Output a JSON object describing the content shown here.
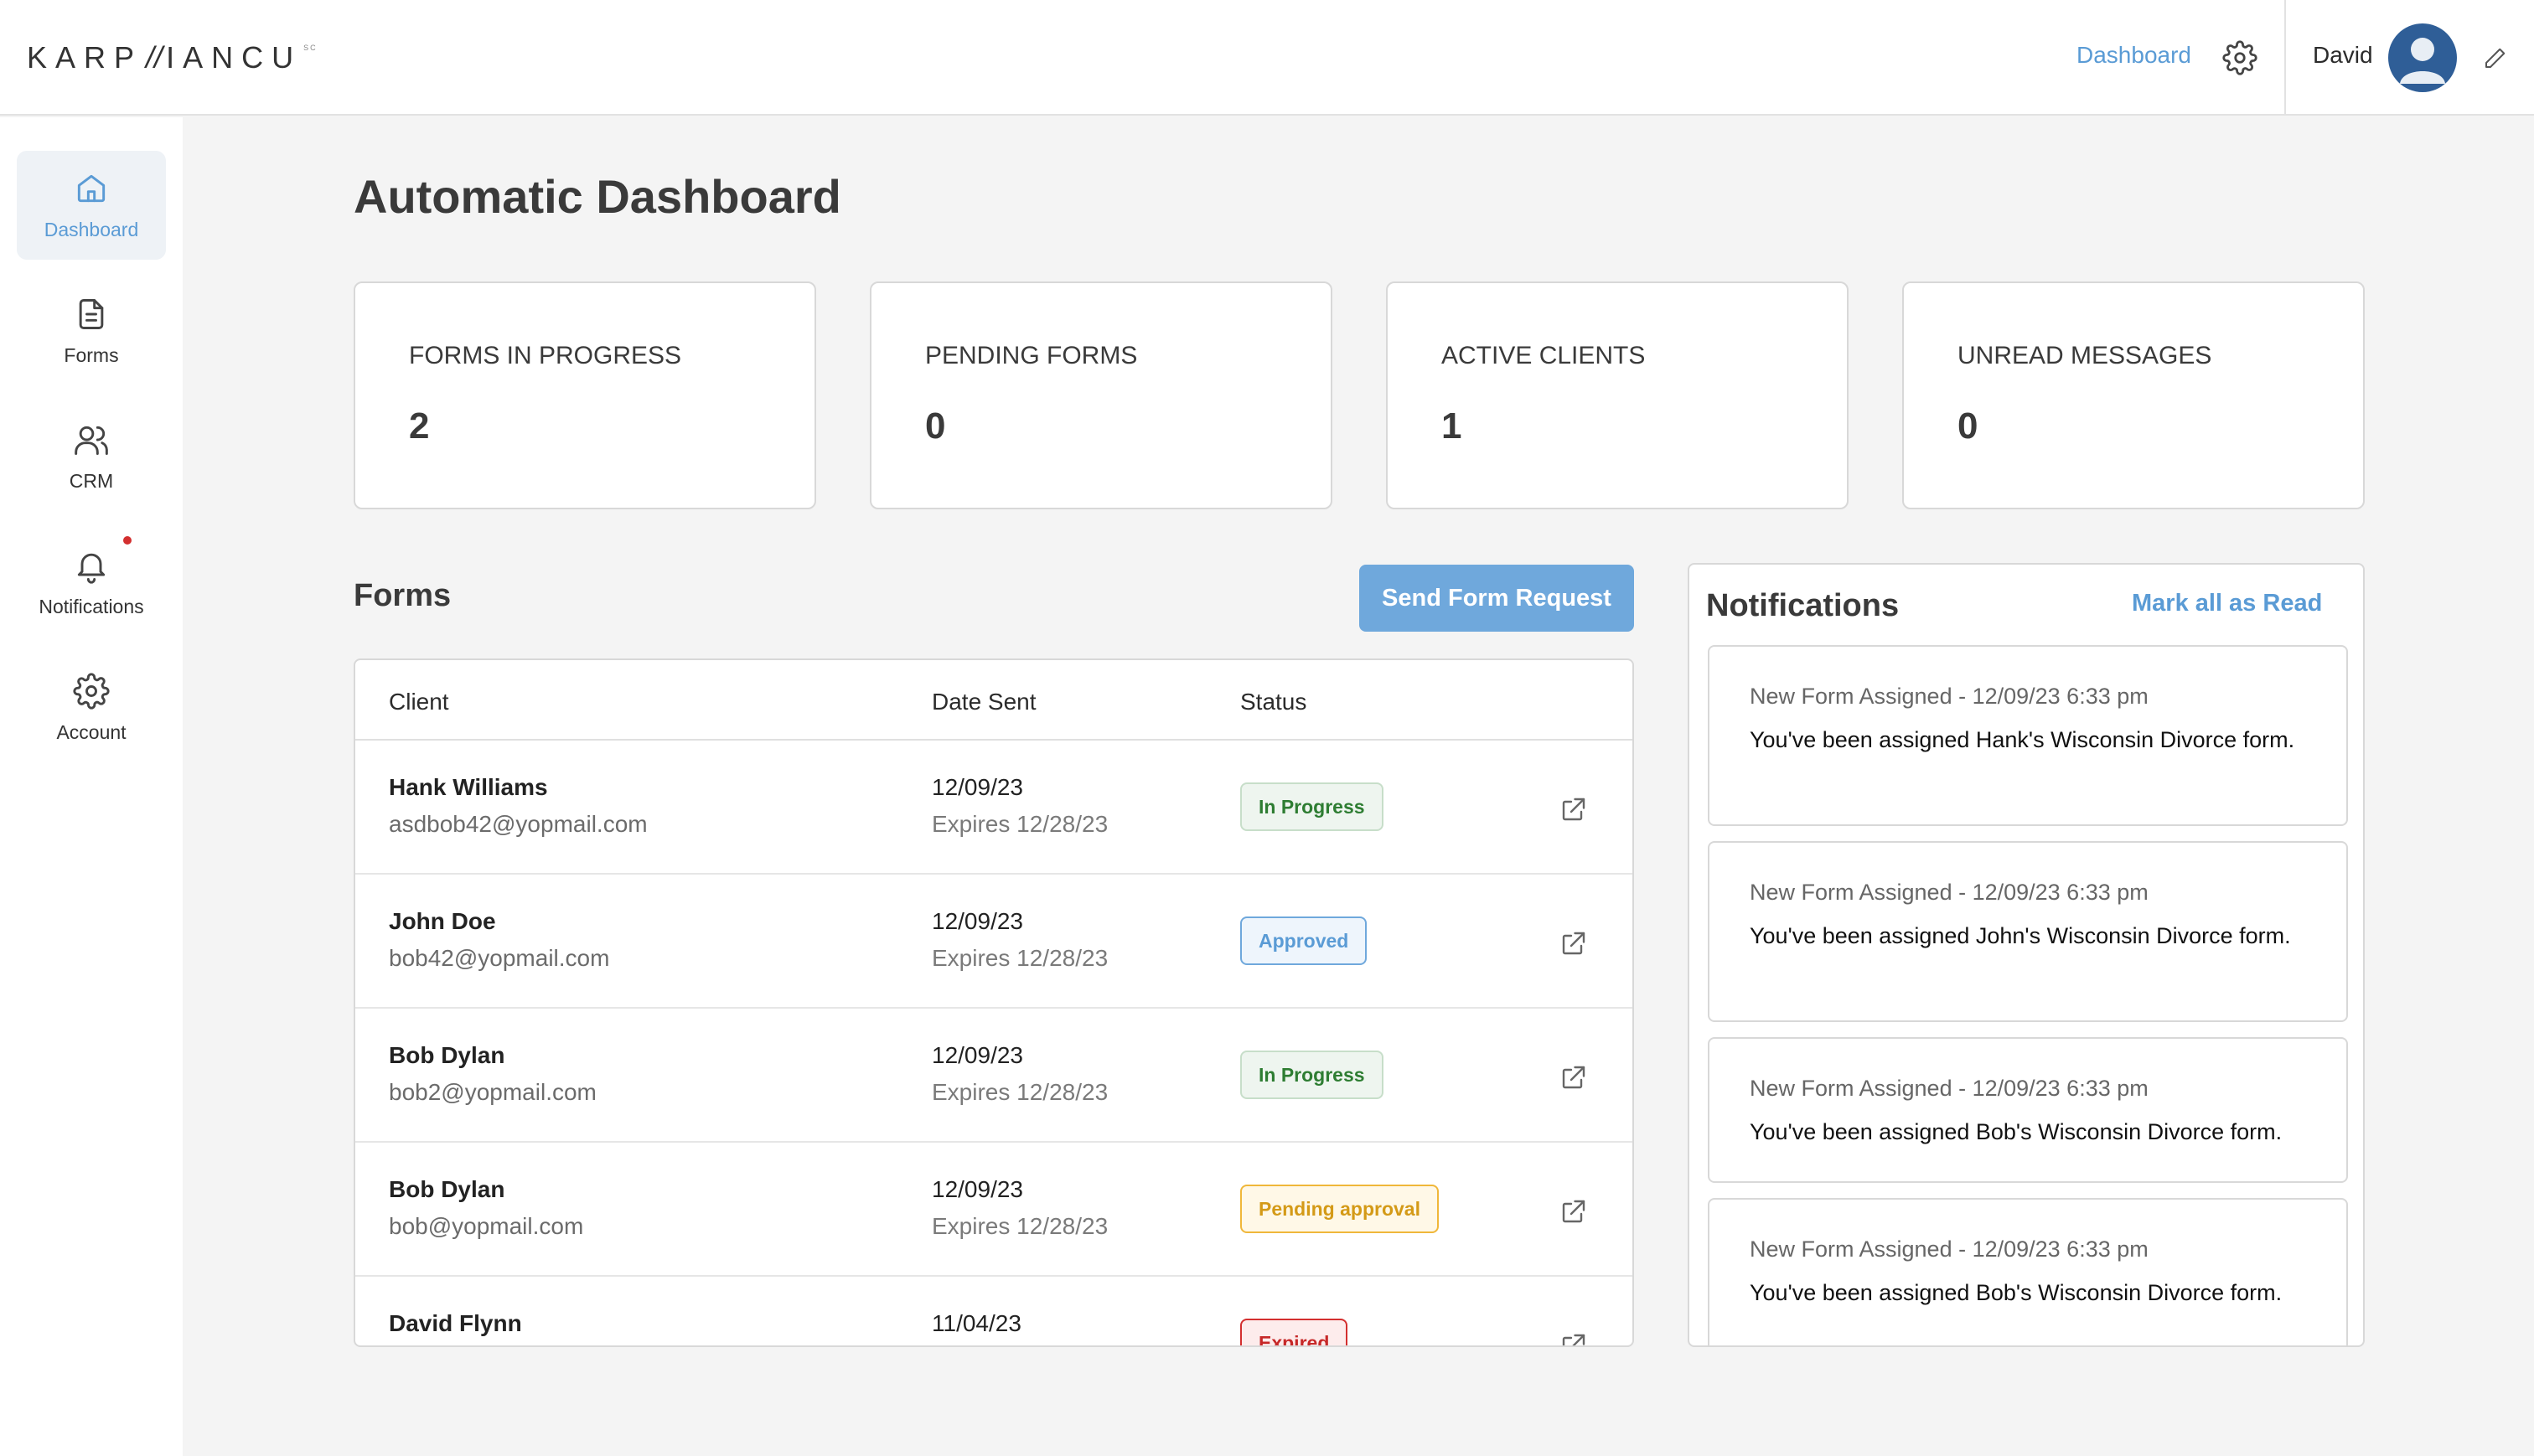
{
  "header": {
    "logo_main": "KARP",
    "logo_slash": "//",
    "logo_tail": "IANCU",
    "logo_sup": "SC",
    "nav_link": "Dashboard",
    "user_name": "David",
    "icons": [
      "gear-icon",
      "avatar",
      "pencil-icon"
    ]
  },
  "sidebar": {
    "items": [
      {
        "label": "Dashboard",
        "icon": "home-icon",
        "active": true
      },
      {
        "label": "Forms",
        "icon": "document-icon"
      },
      {
        "label": "CRM",
        "icon": "users-icon"
      },
      {
        "label": "Notifications",
        "icon": "bell-icon",
        "has_dot": true
      },
      {
        "label": "Account",
        "icon": "gear-icon"
      }
    ]
  },
  "main": {
    "title": "Automatic Dashboard",
    "stats": [
      {
        "label": "FORMS IN PROGRESS",
        "value": "2"
      },
      {
        "label": "PENDING FORMS",
        "value": "0"
      },
      {
        "label": "ACTIVE CLIENTS",
        "value": "1"
      },
      {
        "label": "UNREAD MESSAGES",
        "value": "0"
      }
    ]
  },
  "forms": {
    "title": "Forms",
    "send_button": "Send Form Request",
    "columns": [
      "Client",
      "Date Sent",
      "Status"
    ],
    "rows": [
      {
        "name": "Hank Williams",
        "email": "asdbob42@yopmail.com",
        "date": "12/09/23",
        "expires": "Expires 12/28/23",
        "status": "In Progress"
      },
      {
        "name": "John Doe",
        "email": "bob42@yopmail.com",
        "date": "12/09/23",
        "expires": "Expires 12/28/23",
        "status": "Approved"
      },
      {
        "name": "Bob Dylan",
        "email": "bob2@yopmail.com",
        "date": "12/09/23",
        "expires": "Expires 12/28/23",
        "status": "In Progress"
      },
      {
        "name": "Bob Dylan",
        "email": "bob@yopmail.com",
        "date": "12/09/23",
        "expires": "Expires 12/28/23",
        "status": "Pending approval"
      },
      {
        "name": "David Flynn",
        "email": "",
        "date": "11/04/23",
        "expires": "",
        "status": "Expired"
      }
    ]
  },
  "notifications": {
    "title": "Notifications",
    "mark_all": "Mark all as Read",
    "items": [
      {
        "meta": "New Form Assigned - 12/09/23 6:33 pm",
        "text": "You've been assigned Hank's  Wisconsin Divorce form."
      },
      {
        "meta": "New Form Assigned - 12/09/23 6:33 pm",
        "text": "You've been assigned John's  Wisconsin Divorce form."
      },
      {
        "meta": "New Form Assigned - 12/09/23 6:33 pm",
        "text": "You've been assigned Bob's  Wisconsin Divorce form."
      },
      {
        "meta": "New Form Assigned - 12/09/23 6:33 pm",
        "text": "You've been assigned Bob's  Wisconsin Divorce form."
      }
    ]
  },
  "colors": {
    "accent": "#5a9bd5",
    "button": "#6fa8dc",
    "in_progress": "#2e7d32",
    "pending": "#d49a17",
    "expired": "#c62828"
  }
}
